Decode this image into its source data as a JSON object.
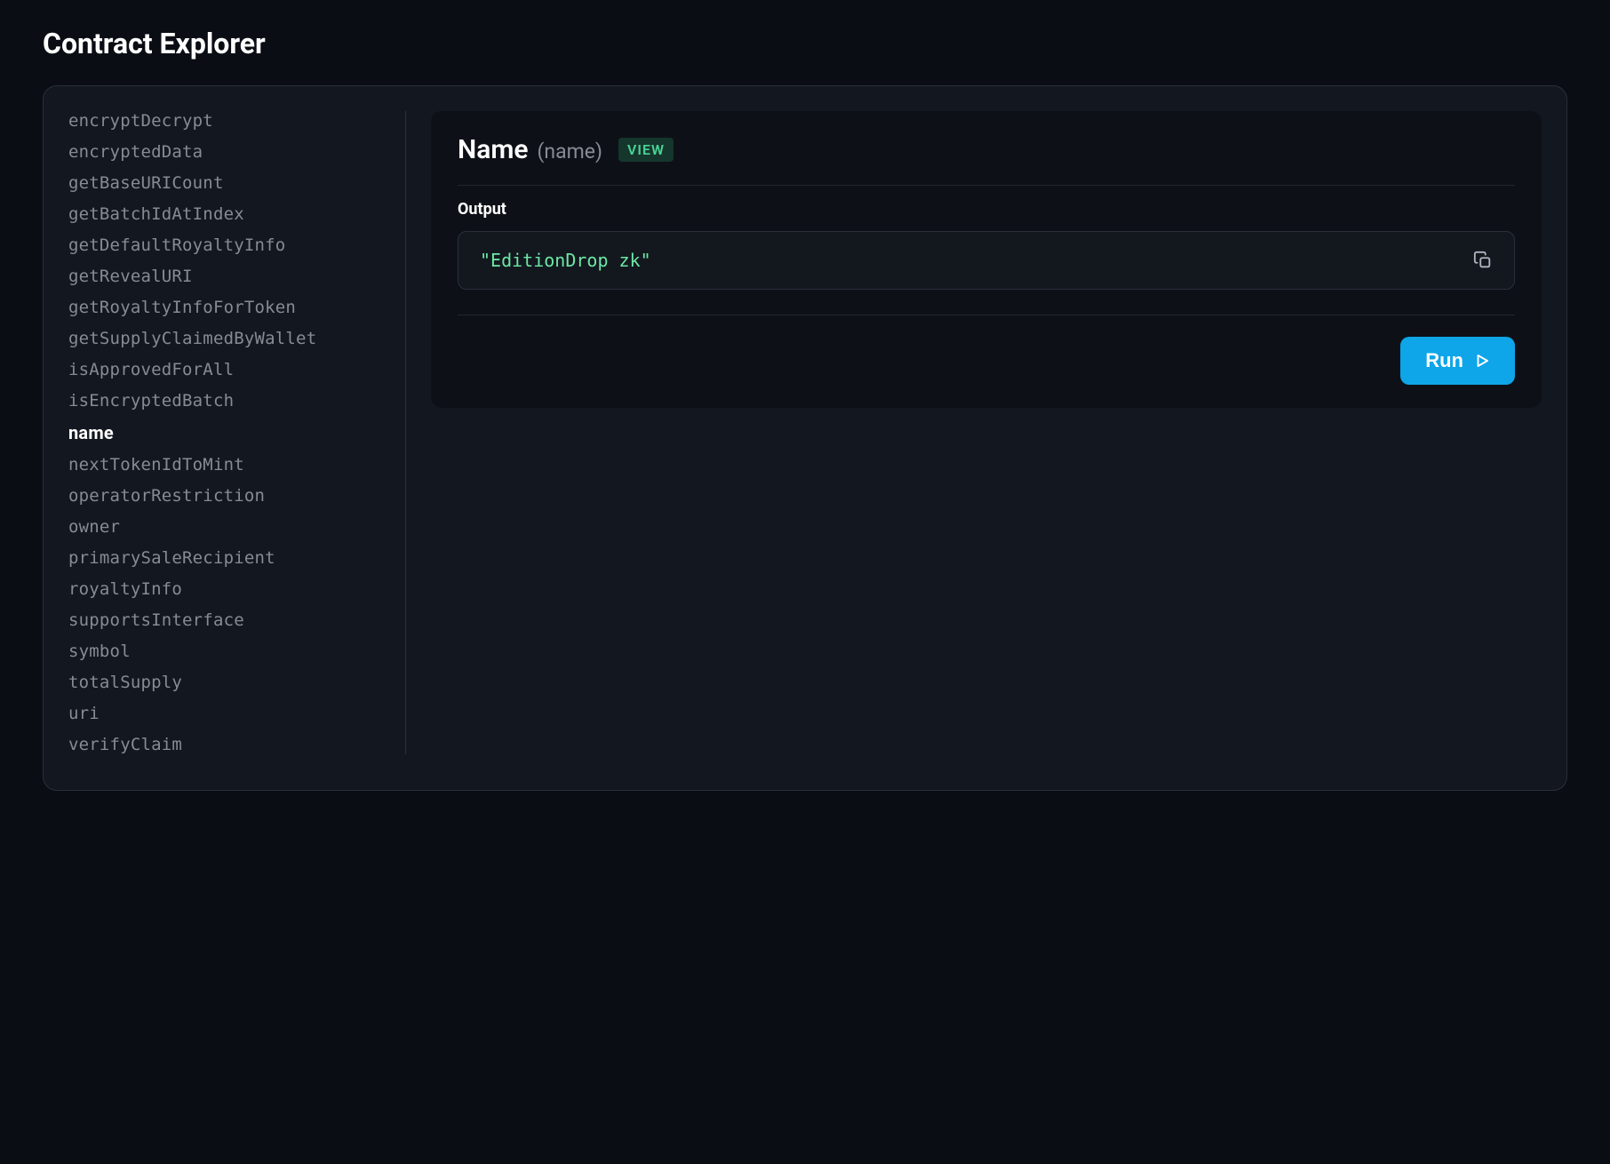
{
  "page_title": "Contract Explorer",
  "sidebar": {
    "items": [
      {
        "label": "encryptDecrypt",
        "active": false
      },
      {
        "label": "encryptedData",
        "active": false
      },
      {
        "label": "getBaseURICount",
        "active": false
      },
      {
        "label": "getBatchIdAtIndex",
        "active": false
      },
      {
        "label": "getDefaultRoyaltyInfo",
        "active": false
      },
      {
        "label": "getRevealURI",
        "active": false
      },
      {
        "label": "getRoyaltyInfoForToken",
        "active": false
      },
      {
        "label": "getSupplyClaimedByWallet",
        "active": false
      },
      {
        "label": "isApprovedForAll",
        "active": false
      },
      {
        "label": "isEncryptedBatch",
        "active": false
      },
      {
        "label": "name",
        "active": true
      },
      {
        "label": "nextTokenIdToMint",
        "active": false
      },
      {
        "label": "operatorRestriction",
        "active": false
      },
      {
        "label": "owner",
        "active": false
      },
      {
        "label": "primarySaleRecipient",
        "active": false
      },
      {
        "label": "royaltyInfo",
        "active": false
      },
      {
        "label": "supportsInterface",
        "active": false
      },
      {
        "label": "symbol",
        "active": false
      },
      {
        "label": "totalSupply",
        "active": false
      },
      {
        "label": "uri",
        "active": false
      },
      {
        "label": "verifyClaim",
        "active": false
      }
    ]
  },
  "method": {
    "display_name": "Name",
    "signature": "(name)",
    "badge": "VIEW",
    "output_label": "Output",
    "output_value": "\"EditionDrop zk\"",
    "run_label": "Run"
  }
}
